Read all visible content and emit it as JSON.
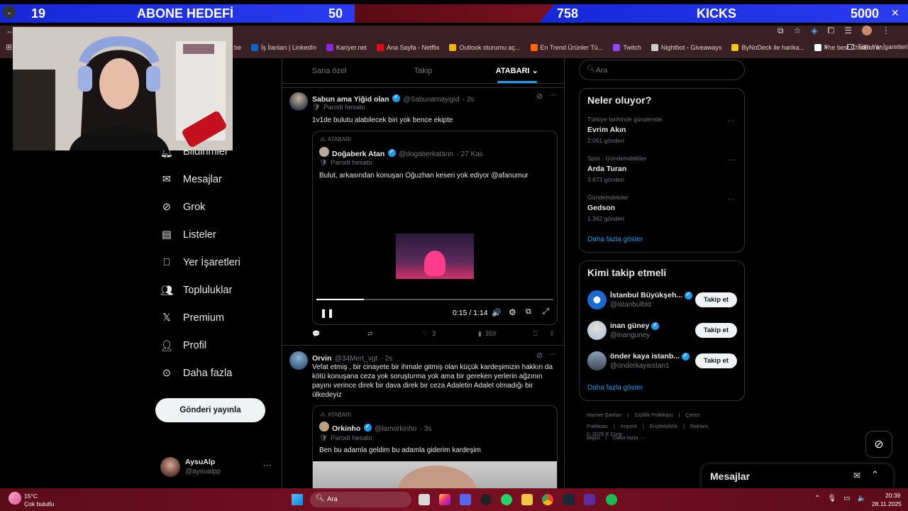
{
  "overlay": {
    "left_count": "19",
    "left_label": "ABONE HEDEFİ",
    "left_goal": "50",
    "right_count": "758",
    "right_label": "KICKS",
    "right_goal": "5000"
  },
  "bookmarks": [
    {
      "label": "be",
      "color": "#ff0000"
    },
    {
      "label": "İş İlanları | LinkedIn",
      "color": "#0a66c2"
    },
    {
      "label": "Kariyer.net",
      "color": "#8a2be2"
    },
    {
      "label": "Ana Sayfa - Netflix",
      "color": "#e50914"
    },
    {
      "label": "Outlook oturumu aç...",
      "color": "#f4b400"
    },
    {
      "label": "En Trend Ürünler Tü...",
      "color": "#ff6600"
    },
    {
      "label": "Twitch",
      "color": "#9146ff"
    },
    {
      "label": "Nightbot - Giveaways",
      "color": "#cccccc"
    },
    {
      "label": "ByNoDeck ile harika...",
      "color": "#f5c518"
    },
    {
      "label": "The best ChatBot an...",
      "color": "#ffffff"
    }
  ],
  "bookmarks_more": "»",
  "bookmarks_folder": "Tüm Yer İşaretleri",
  "nav": {
    "items": [
      {
        "label": "Bildirimler",
        "icon": "bell-icon"
      },
      {
        "label": "Mesajlar",
        "icon": "mail-icon"
      },
      {
        "label": "Grok",
        "icon": "grok-icon"
      },
      {
        "label": "Listeler",
        "icon": "list-icon"
      },
      {
        "label": "Yer İşaretleri",
        "icon": "bookmark-icon"
      },
      {
        "label": "Topluluklar",
        "icon": "communities-icon"
      },
      {
        "label": "Premium",
        "icon": "x-logo-icon"
      },
      {
        "label": "Profil",
        "icon": "profile-icon"
      },
      {
        "label": "Daha fazla",
        "icon": "more-circle-icon"
      }
    ],
    "post_button": "Gönderi yayınla",
    "account_name": "AysuAlp",
    "account_handle": "@aysualpp",
    "account_more": "···"
  },
  "tabs": [
    {
      "label": "Sana özel"
    },
    {
      "label": "Takip"
    },
    {
      "label": "ATABARI ⌄"
    }
  ],
  "post1": {
    "name": "Sabun ama Yiğid olan",
    "handle": "@Sabunamayigid",
    "time": "· 2s",
    "parody": "Parodi hesabı",
    "text": "1v1de bulutu alabilecek biri yok bence ekipte",
    "quote": {
      "community": "ATABARI",
      "name": "Doğaberk Atan",
      "handle": "@dogaberkatann",
      "time": "· 27 Kas",
      "parody": "Parodi hesabı",
      "text": "Bulut, arkasından konuşan Oğuzhan keseri yok ediyor @afanumur",
      "time_label": "0:15 / 1:14",
      "progress": 0.2
    },
    "stats": {
      "replies": "",
      "reposts": "",
      "likes": "3",
      "views": "359"
    }
  },
  "post2": {
    "name": "Orvin",
    "handle": "@34Mert_vgt",
    "time": "· 2s",
    "text": "Vefat etmiş , bir cinayete bir ihmale gitmiş olan küçük kardeşimizin hakkın da kötü konuşana ceza yok soruşturma yok ama bir gereken yerlerin ağzının payını verince direk bir dava direk bir ceza Adaletin Adalet olmadığı bir ülkedeyiz",
    "quote": {
      "community": "ATABARI",
      "name": "Orkinho",
      "handle": "@lamorkinho",
      "time": "· 3s",
      "parody": "Parodi hesabı",
      "text": "Ben bu adamla geldim bu adamla giderim kardeşim"
    }
  },
  "search": {
    "placeholder": "Ara"
  },
  "trends": {
    "title": "Neler oluyor?",
    "items": [
      {
        "context": "Türkiye tarihinde gündemde",
        "name": "Evrim Akın",
        "count": "2.061 gönderi"
      },
      {
        "context": "Spor · Gündemdekiler",
        "name": "Arda Turan",
        "count": "3.673 gönderi"
      },
      {
        "context": "Gündemdekiler",
        "name": "Gedson",
        "count": "1.362 gönderi"
      }
    ],
    "more": "Daha fazla göster"
  },
  "follow": {
    "title": "Kimi takip etmeli",
    "items": [
      {
        "name": "İstanbul Büyükşeh...",
        "handle": "@istanbulbld",
        "button": "Takip et"
      },
      {
        "name": "inan güney",
        "handle": "@inanguney",
        "button": "Takip et"
      },
      {
        "name": "önder kaya istanb...",
        "handle": "@onderkayaistan1",
        "button": "Takip et"
      }
    ],
    "more": "Daha fazla göster"
  },
  "footer": {
    "links": [
      "Hizmet Şartları",
      "|",
      "Gizlilik Politikası",
      "|",
      "Çerez Politikası",
      "|",
      "Imprint",
      "|",
      "Erişilebilirlik",
      "|",
      "Reklam bilgisi",
      "|",
      "Daha fazla ···"
    ],
    "copyright": "© 2025 X Corp."
  },
  "messages_drawer": {
    "title": "Mesajlar"
  },
  "taskbar": {
    "weather_temp": "15°C",
    "weather_desc": "Çok bulutlu",
    "search_placeholder": "Ara",
    "time": "20:39",
    "date": "28.11.2025"
  }
}
